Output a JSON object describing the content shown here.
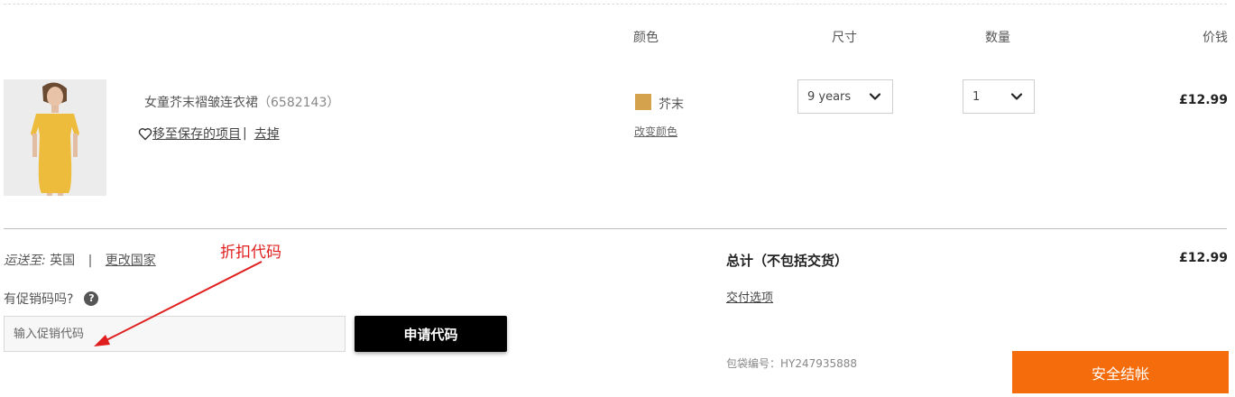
{
  "columns": {
    "color": "颜色",
    "size": "尺寸",
    "quantity": "数量",
    "price": "价钱"
  },
  "item": {
    "name": "女童芥末褶皱连衣裙",
    "code": "（6582143）",
    "save_label": "移至保存的项目",
    "remove_label": "去掉",
    "color_name": "芥末",
    "color_hex": "#d4a24c",
    "change_color_label": "改变颜色",
    "size_selected": "9 years",
    "quantity_selected": "1",
    "price": "£12.99"
  },
  "shipping": {
    "label": "运送至:",
    "country": "英国",
    "separator": "|",
    "change_label": "更改国家"
  },
  "promo": {
    "question": "有促销码吗?",
    "help_symbol": "?",
    "placeholder": "输入促销代码",
    "apply_label": "申请代码",
    "annotation": "折扣代码"
  },
  "summary": {
    "total_label": "总计（不包括交货）",
    "total_value": "£12.99",
    "delivery_options": "交付选项",
    "bag_number": "包袋编号：HY247935888",
    "checkout_label": "安全结帐"
  },
  "colors": {
    "checkout": "#f46c0c",
    "annotation": "#e01e1e",
    "apply": "#000000"
  },
  "icons": {
    "heart": "heart-icon",
    "chevron": "chevron-down-icon",
    "help": "help-icon",
    "arrow": "annotation-arrow"
  }
}
